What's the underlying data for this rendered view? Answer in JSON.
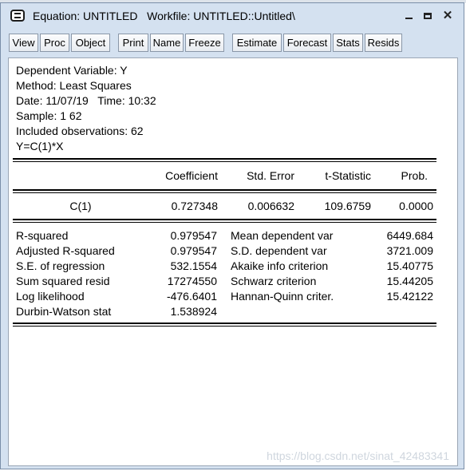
{
  "window": {
    "title": "Equation: UNTITLED   Workfile: UNTITLED::Untitled\\",
    "minimize_glyph": "_",
    "close_glyph": "✕"
  },
  "toolbar": {
    "view": "View",
    "proc": "Proc",
    "object": "Object",
    "print": "Print",
    "name": "Name",
    "freeze": "Freeze",
    "estimate": "Estimate",
    "forecast": "Forecast",
    "stats": "Stats",
    "resids": "Resids"
  },
  "header": {
    "dependent": "Dependent Variable: Y",
    "method": "Method: Least Squares",
    "date": "Date: 11/07/19   Time: 10:32",
    "sample": "Sample: 1 62",
    "included": "Included observations: 62",
    "equation": "Y=C(1)*X"
  },
  "coef_table": {
    "col_coefficient": "Coefficient",
    "col_std_error": "Std. Error",
    "col_t_stat": "t-Statistic",
    "col_prob": "Prob.",
    "row_var": "C(1)",
    "row_coef": "0.727348",
    "row_se": "0.006632",
    "row_t": "109.6759",
    "row_p": "0.0000"
  },
  "stats_left": [
    {
      "label": "R-squared",
      "value": "0.979547"
    },
    {
      "label": "Adjusted R-squared",
      "value": "0.979547"
    },
    {
      "label": "S.E. of regression",
      "value": "532.1554"
    },
    {
      "label": "Sum squared resid",
      "value": "17274550"
    },
    {
      "label": "Log likelihood",
      "value": "-476.6401"
    },
    {
      "label": "Durbin-Watson stat",
      "value": "1.538924"
    }
  ],
  "stats_right": [
    {
      "label": "Mean dependent var",
      "value": "6449.684"
    },
    {
      "label": "S.D. dependent var",
      "value": "3721.009"
    },
    {
      "label": "Akaike info criterion",
      "value": "15.40775"
    },
    {
      "label": "Schwarz criterion",
      "value": "15.44205"
    },
    {
      "label": "Hannan-Quinn criter.",
      "value": "15.42122"
    }
  ],
  "watermark": "https://blog.csdn.net/sinat_42483341"
}
